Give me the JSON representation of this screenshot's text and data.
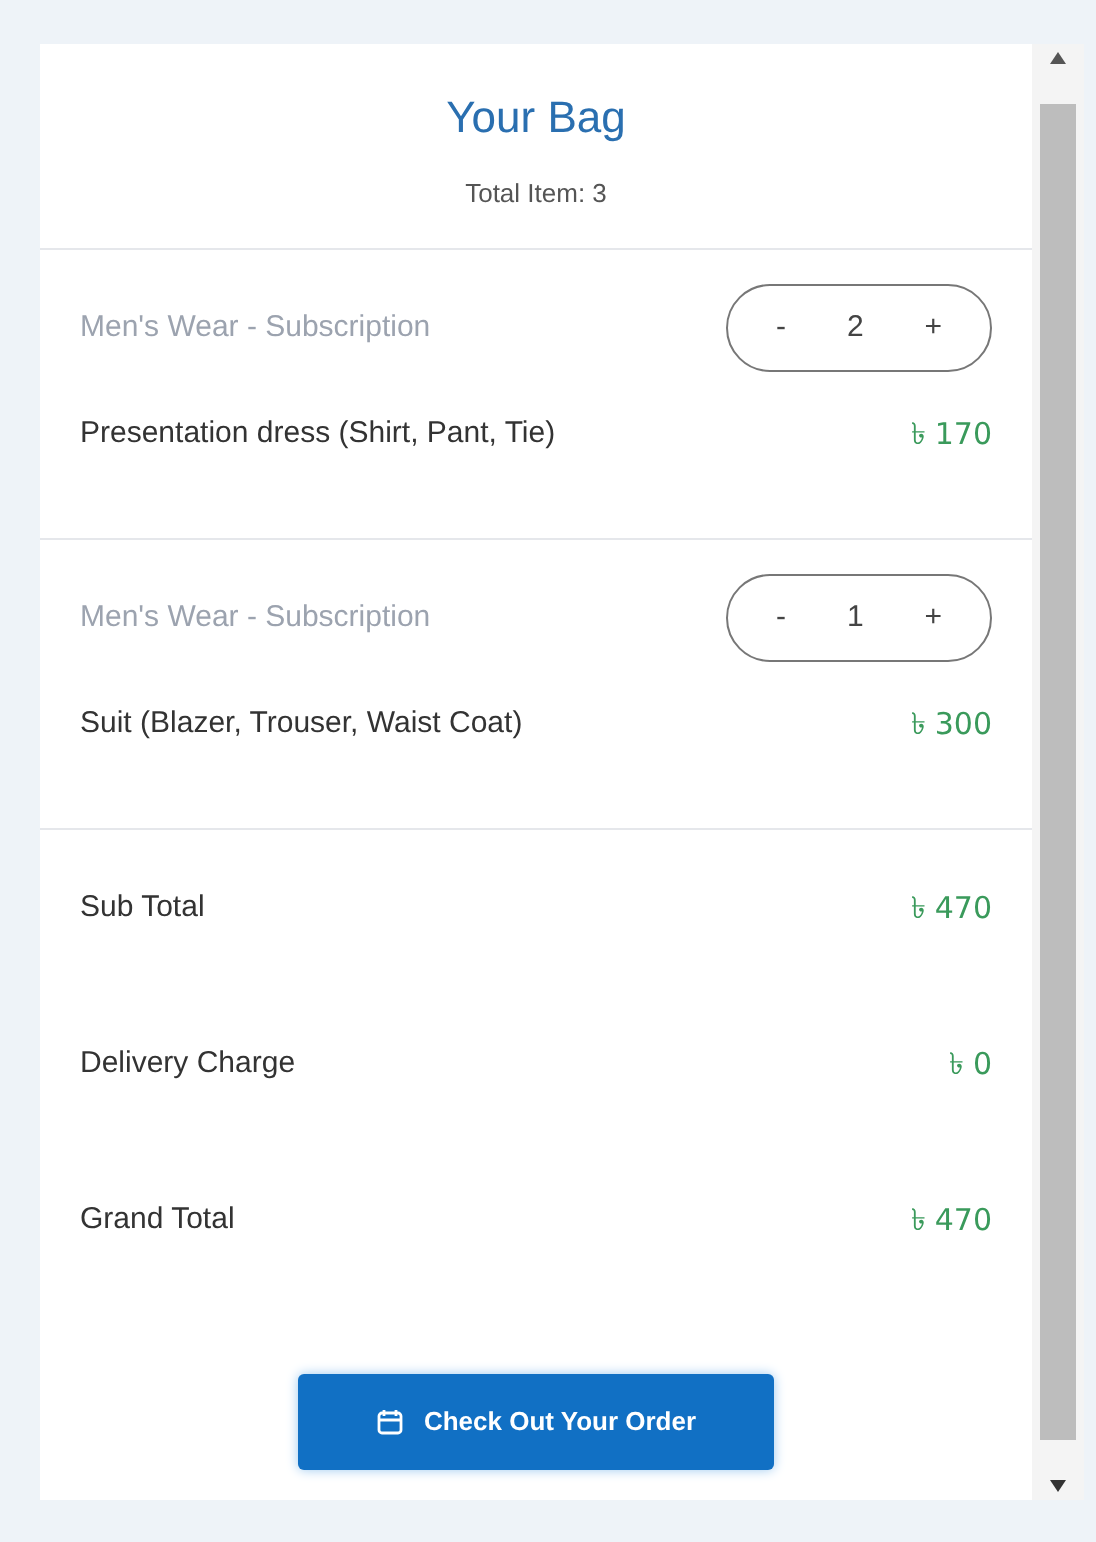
{
  "header": {
    "title": "Your Bag",
    "total_items": "Total Item: 3"
  },
  "items": [
    {
      "category": "Men's Wear - Subscription",
      "name": "Presentation dress (Shirt, Pant, Tie)",
      "price": "৳ 170",
      "minus": "-",
      "quantity": "2",
      "plus": "+"
    },
    {
      "category": "Men's Wear - Subscription",
      "name": "Suit (Blazer, Trouser, Waist Coat)",
      "price": "৳ 300",
      "minus": "-",
      "quantity": "1",
      "plus": "+"
    }
  ],
  "summary": [
    {
      "label": "Sub Total",
      "value": "৳ 470"
    },
    {
      "label": "Delivery Charge",
      "value": "৳ 0"
    },
    {
      "label": "Grand Total",
      "value": "৳ 470"
    }
  ],
  "checkout_button": "Check Out Your Order"
}
